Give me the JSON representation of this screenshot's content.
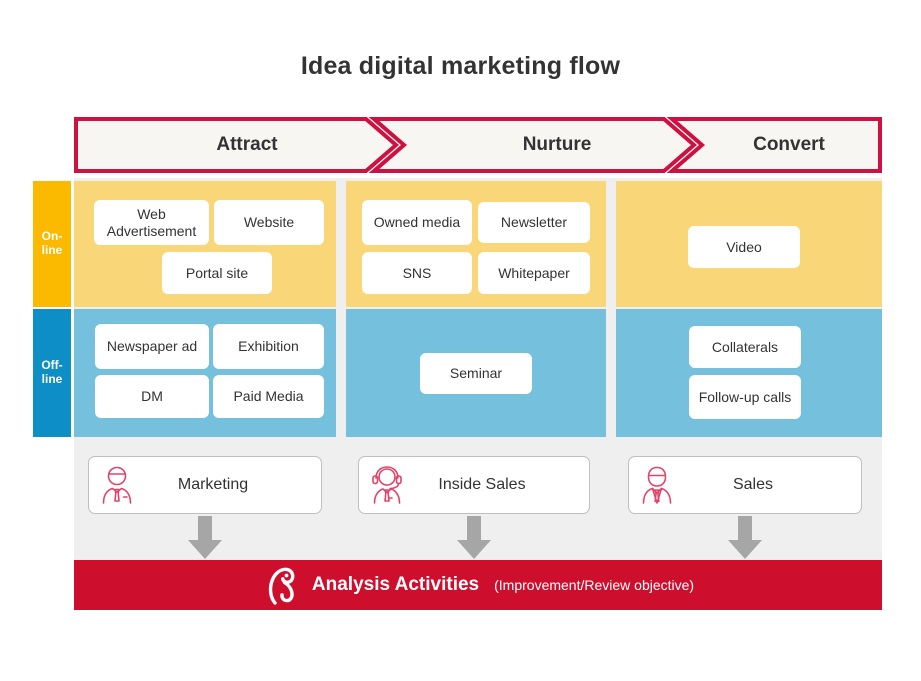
{
  "page": {
    "title": "Idea digital marketing flow",
    "background": "#ffffff"
  },
  "colors": {
    "brand_red": "#ce0e2d",
    "header_border": "#ce1141",
    "header_fill": "#f8f6f3",
    "online_tab": "#fbb900",
    "online_band": "#f9d779",
    "offline_tab": "#0d8ec4",
    "offline_band": "#74c0dd",
    "panel_grey": "#efefef",
    "arrow_grey": "#a6a6a6",
    "text_dark": "#333333"
  },
  "stages": [
    {
      "label": "Attract"
    },
    {
      "label": "Nurture"
    },
    {
      "label": "Convert"
    }
  ],
  "channel_rows": [
    {
      "key": "online",
      "label_line1": "On-",
      "label_line2": "line",
      "columns": [
        {
          "chips": [
            "Web Advertisement",
            "Website",
            "Portal site"
          ]
        },
        {
          "chips": [
            "Owned media",
            "Newsletter",
            "SNS",
            "Whitepaper"
          ]
        },
        {
          "chips": [
            "Video"
          ]
        }
      ]
    },
    {
      "key": "offline",
      "label_line1": "Off-",
      "label_line2": "line",
      "columns": [
        {
          "chips": [
            "Newspaper ad",
            "Exhibition",
            "DM",
            "Paid Media"
          ]
        },
        {
          "chips": [
            "Seminar"
          ]
        },
        {
          "chips": [
            "Collaterals",
            "Follow-up calls"
          ]
        }
      ]
    }
  ],
  "roles": [
    {
      "label": "Marketing",
      "icon": "person-cap-tie-icon"
    },
    {
      "label": "Inside Sales",
      "icon": "person-headset-icon"
    },
    {
      "label": "Sales",
      "icon": "person-suit-icon"
    }
  ],
  "arrows": [
    {
      "name": "down-arrow-attract"
    },
    {
      "name": "down-arrow-nurture"
    },
    {
      "name": "down-arrow-convert"
    }
  ],
  "analysis": {
    "logo": "company-mark-icon",
    "title": "Analysis Activities",
    "subtitle": "(Improvement/Review objective)"
  }
}
